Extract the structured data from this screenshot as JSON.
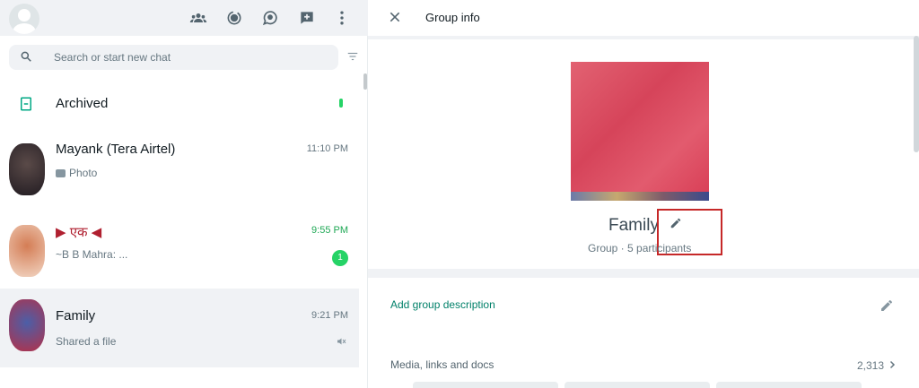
{
  "left_header": {
    "icons": [
      "communities-icon",
      "status-icon",
      "channels-icon",
      "new-chat-icon",
      "menu-icon"
    ]
  },
  "search": {
    "placeholder": "Search or start new chat"
  },
  "archived": {
    "label": "Archived"
  },
  "chats": [
    {
      "name": "Mayank (Tera Airtel)",
      "preview": "Photo",
      "time": "11:10 PM",
      "avatar_color": "#3a2f35"
    },
    {
      "name": "▶ एक ◀",
      "preview": "~B B Mahra: ...",
      "time": "9:55 PM",
      "unread": "1",
      "avatar_color": "#e8b9a0"
    },
    {
      "name": "Family",
      "preview": "Shared a file",
      "time": "9:21 PM",
      "avatar_color": "#b43048"
    }
  ],
  "group_info": {
    "title": "Group info",
    "group_name": "Family",
    "subtitle": "Group · 5 participants",
    "add_description": "Add group description",
    "media_label": "Media, links and docs",
    "media_count": "2,313"
  },
  "colors": {
    "accent": "#00a884",
    "link": "#008069",
    "highlight": "#c62828"
  }
}
